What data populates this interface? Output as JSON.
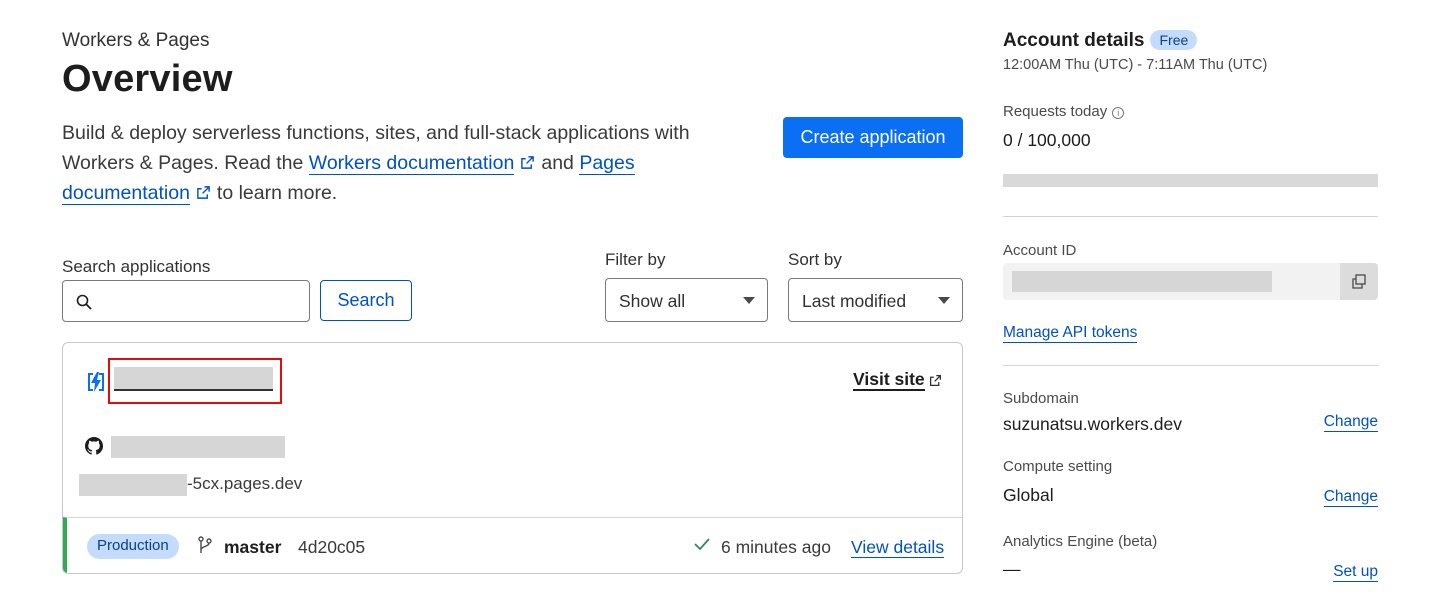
{
  "header": {
    "breadcrumb": "Workers & Pages",
    "title": "Overview",
    "intro_text_1": "Build & deploy serverless functions, sites, and full-stack applications with Workers & Pages. Read the",
    "workers_doc_link": "Workers documentation",
    "intro_text_2": "and",
    "pages_doc_link": "Pages documentation",
    "intro_text_3": "to learn more.",
    "create_button": "Create application"
  },
  "search": {
    "label": "Search applications",
    "placeholder": "",
    "value": "",
    "button": "Search"
  },
  "filter": {
    "label": "Filter by",
    "selected": "Show all"
  },
  "sort": {
    "label": "Sort by",
    "selected": "Last modified"
  },
  "app_card": {
    "visit_site": "Visit site",
    "domain_suffix": "-5cx.pages.dev",
    "environment": "Production",
    "branch": "master",
    "commit": "4d20c05",
    "deployed_ago": "6 minutes ago",
    "view_details": "View details",
    "status_color": "#34a853"
  },
  "account": {
    "title": "Account details",
    "plan": "Free",
    "time_range": "12:00AM Thu (UTC) - 7:11AM Thu (UTC)",
    "requests_label": "Requests today",
    "requests_value": "0 / 100,000",
    "account_id_label": "Account ID",
    "manage_tokens": "Manage API tokens",
    "subdomain_label": "Subdomain",
    "subdomain_value": "suzunatsu.workers.dev",
    "subdomain_change": "Change",
    "compute_label": "Compute setting",
    "compute_value": "Global",
    "compute_change": "Change",
    "analytics_label": "Analytics Engine (beta)",
    "analytics_value": "—",
    "analytics_setup": "Set up"
  },
  "colors": {
    "accent": "#0b6ff3",
    "link": "#0051c3",
    "badge_bg": "#c3dcfb",
    "highlight_border": "#e10d0d"
  },
  "icons": [
    "search-icon",
    "chevron-down-icon",
    "worker-icon",
    "external-link-icon",
    "github-icon",
    "branch-icon",
    "check-icon",
    "info-icon",
    "copy-icon"
  ]
}
